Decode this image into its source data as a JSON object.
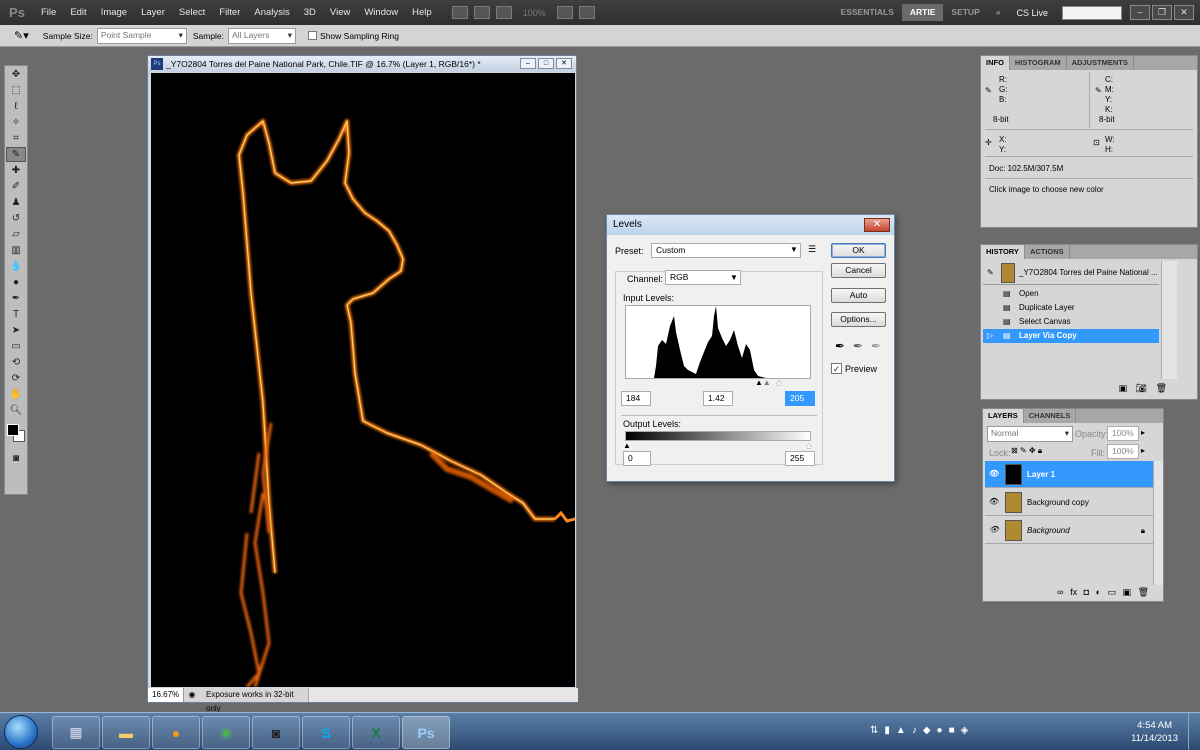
{
  "app": {
    "logo": "Ps"
  },
  "menubar": {
    "items": [
      "File",
      "Edit",
      "Image",
      "Layer",
      "Select",
      "Filter",
      "Analysis",
      "3D",
      "View",
      "Window",
      "Help"
    ],
    "zoom": "100%",
    "workspaces": [
      "ESSENTIALS",
      "ARTIE",
      "SETUP"
    ],
    "active_workspace": "ARTIE",
    "cs_live": "CS Live"
  },
  "options_bar": {
    "sample_size_label": "Sample Size:",
    "sample_size_value": "Point Sample",
    "sample_label": "Sample:",
    "sample_value": "All Layers",
    "ring_label": "Show Sampling Ring"
  },
  "document": {
    "title": "_Y7O2804  Torres del Paine National Park, Chile.TIF @ 16.7% (Layer 1, RGB/16*) *",
    "zoom": "16.67%",
    "status": "Exposure works in 32-bit only"
  },
  "levels": {
    "title": "Levels",
    "preset_label": "Preset:",
    "preset_value": "Custom",
    "channel_label": "Channel:",
    "channel_value": "RGB",
    "input_label": "Input Levels:",
    "input_black": "184",
    "input_gamma": "1.42",
    "input_white": "205",
    "output_label": "Output Levels:",
    "output_black": "0",
    "output_white": "255",
    "buttons": {
      "ok": "OK",
      "cancel": "Cancel",
      "auto": "Auto",
      "options": "Options..."
    },
    "preview_label": "Preview",
    "preview_checked": true
  },
  "info_panel": {
    "tabs": [
      "INFO",
      "HISTOGRAM",
      "ADJUSTMENTS"
    ],
    "rgb": [
      "R:",
      "G:",
      "B:"
    ],
    "cmyk": [
      "C:",
      "M:",
      "Y:",
      "K:"
    ],
    "bit_left": "8-bit",
    "bit_right": "8-bit",
    "xy": [
      "X:",
      "Y:"
    ],
    "wh": [
      "W:",
      "H:"
    ],
    "doc": "Doc: 102.5M/307.5M",
    "hint": "Click image to choose new color"
  },
  "history_panel": {
    "tabs": [
      "HISTORY",
      "ACTIONS"
    ],
    "snapshot": "_Y7O2804  Torres del Paine National ...",
    "items": [
      "Open",
      "Duplicate Layer",
      "Select Canvas",
      "Layer Via Copy"
    ],
    "selected_index": 3
  },
  "layers_panel": {
    "tabs": [
      "LAYERS",
      "CHANNELS"
    ],
    "blend_mode": "Normal",
    "opacity_label": "Opacity:",
    "opacity": "100%",
    "lock_label": "Lock:",
    "fill_label": "Fill:",
    "fill": "100%",
    "layers": [
      "Layer 1",
      "Background copy",
      "Background"
    ],
    "selected_index": 0
  },
  "taskbar": {
    "time": "4:54 AM",
    "date": "11/14/2013"
  },
  "colors": {
    "accent_blue": "#3399ff",
    "flame": "#ff7a10",
    "panel_bg": "#d6d6d6"
  },
  "icons": [
    "move-tool-icon",
    "marquee-tool-icon",
    "lasso-tool-icon",
    "quick-select-icon",
    "crop-tool-icon",
    "eyedropper-tool-icon",
    "healing-brush-icon",
    "brush-tool-icon",
    "clone-stamp-icon",
    "history-brush-icon",
    "eraser-tool-icon",
    "gradient-tool-icon",
    "blur-tool-icon",
    "dodge-tool-icon",
    "pen-tool-icon",
    "type-tool-icon",
    "path-select-icon",
    "shape-tool-icon",
    "3d-rotate-icon",
    "3d-orbit-icon",
    "hand-tool-icon",
    "zoom-tool-icon"
  ]
}
